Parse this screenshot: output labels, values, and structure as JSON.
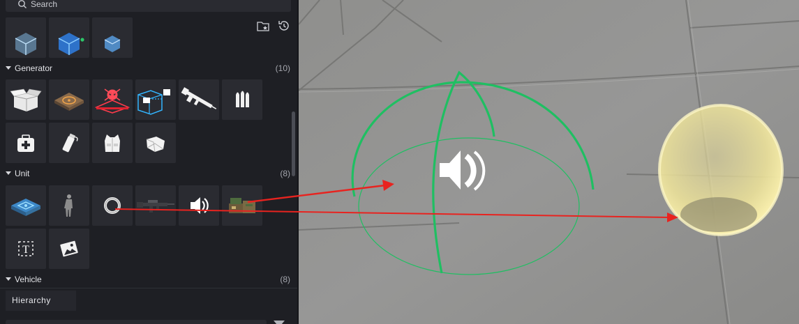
{
  "search": {
    "placeholder": "Search"
  },
  "category_tabs": [
    {
      "icon": "gamepad-icon",
      "active": true
    },
    {
      "icon": "tree-icon",
      "active": false
    },
    {
      "icon": "building-icon",
      "active": false
    },
    {
      "icon": "magic-wand-icon",
      "active": false
    }
  ],
  "tools": [
    {
      "icon": "folder-star-icon"
    },
    {
      "icon": "history-icon"
    }
  ],
  "sections": {
    "generator": {
      "name": "Generator",
      "count": "(10)"
    },
    "unit": {
      "name": "Unit",
      "count": "(8)"
    },
    "vehicle": {
      "name": "Vehicle",
      "count": "(8)"
    }
  },
  "generator_items": [
    {
      "icon": "box-open-icon"
    },
    {
      "icon": "spawn-pad-icon"
    },
    {
      "icon": "skull-zone-icon"
    },
    {
      "icon": "teleport-box-icon"
    },
    {
      "icon": "rifle-icon"
    },
    {
      "icon": "ammo-icon"
    },
    {
      "icon": "medkit-icon"
    },
    {
      "icon": "grenade-icon"
    },
    {
      "icon": "vest-icon"
    },
    {
      "icon": "armor-icon"
    }
  ],
  "unit_items": [
    {
      "icon": "platform-icon"
    },
    {
      "icon": "character-icon"
    },
    {
      "icon": "ring-icon"
    },
    {
      "icon": "assault-rifle-icon"
    },
    {
      "icon": "speaker-icon"
    },
    {
      "icon": "supply-crate-icon"
    },
    {
      "icon": "text-icon",
      "glyph": "T"
    },
    {
      "icon": "image-icon"
    }
  ],
  "hierarchy": {
    "label": "Hierarchy"
  },
  "colors": {
    "accent": "#f0b429",
    "panel": "#1e1f24",
    "tile": "#2a2b31",
    "gizmo_green": "#1fbf62",
    "arrow_red": "#e8231f",
    "sphere_yellow": "#f4ec9c"
  }
}
